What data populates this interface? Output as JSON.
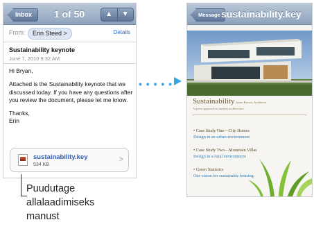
{
  "mail": {
    "inbox_label": "Inbox",
    "message_counter": "1 of 50",
    "up_arrow": "▲",
    "down_arrow": "▼",
    "from_label": "From:",
    "sender": "Erin Steed",
    "sender_chevron": ">",
    "details_label": "Details",
    "subject": "Sustainability keynote",
    "date": "June 7, 2010 9:32 AM",
    "greeting": "Hi Bryan,",
    "body": "Attached is the Sustainability keynote that we discussed today. If you have any questions after you review the document, please let me know.",
    "closing": "Thanks,",
    "signature": "Erin",
    "attachment": {
      "name": "sustainability.key",
      "size": "534 KB",
      "chevron": ">"
    }
  },
  "callout": {
    "line1": "Puudutage",
    "line2": "allalaadimiseks",
    "line3": "manust"
  },
  "arrow_dots": "• • • • •",
  "preview": {
    "back_label": "Message",
    "title": "sustainability.key",
    "slide_title": "Sustainability",
    "slide_byline": "Jason Brown, Architects",
    "slide_subtitle": "A green approach to modern architecture",
    "cases": [
      {
        "heading": "• Case Study One—City Homes",
        "sub": "Design in an urban environment"
      },
      {
        "heading": "• Case Study Two—Mountain Villas",
        "sub": "Design in a rural environment"
      },
      {
        "heading": "• Green Statistics",
        "sub": "Our vision for sustainable housing"
      }
    ]
  },
  "colors": {
    "nav_bar": "#9fb1c8",
    "link_blue": "#2f66c8",
    "arrow_blue": "#37a7e6",
    "slide_link": "#2f7bb5"
  }
}
